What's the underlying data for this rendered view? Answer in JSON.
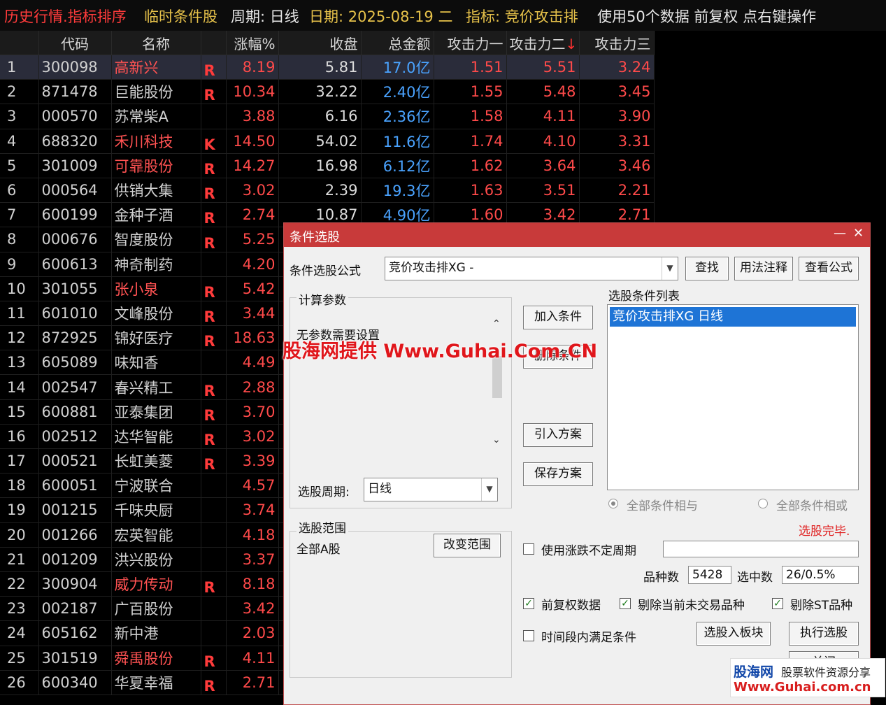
{
  "title_bar": {
    "screen": "历史行情.指标排序",
    "condition": "临时条件股",
    "period": "周期: 日线",
    "date": "日期: 2025-08-19 二",
    "indicator": "指标: 竞价攻击排",
    "data_count": "使用50个数据 前复权 点右键操作"
  },
  "colors": {
    "accent_red": "#c83a3a",
    "up": "#ff4a4a",
    "amount": "#4aa3ff",
    "title_red": "#ff3b3b",
    "title_yellow": "#e7c24a"
  },
  "table": {
    "headers": {
      "code": "代码",
      "name": "名称",
      "pct": "涨幅%",
      "close": "收盘",
      "amount": "总金额",
      "a1": "攻击力一",
      "a2": "攻击力二",
      "a2_sort": "↓",
      "a3": "攻击力三"
    },
    "rows": [
      {
        "idx": "1",
        "code": "300098",
        "name": "高新兴",
        "red": true,
        "flag": "R",
        "pct": "8.19",
        "close": "5.81",
        "amount": "17.0亿",
        "a1": "1.51",
        "a2": "5.51",
        "a3": "3.24"
      },
      {
        "idx": "2",
        "code": "871478",
        "name": "巨能股份",
        "red": false,
        "flag": "R",
        "pct": "10.34",
        "close": "32.22",
        "amount": "2.40亿",
        "a1": "1.55",
        "a2": "5.48",
        "a3": "3.45"
      },
      {
        "idx": "3",
        "code": "000570",
        "name": "苏常柴A",
        "red": false,
        "flag": "",
        "pct": "3.88",
        "close": "6.16",
        "amount": "2.36亿",
        "a1": "1.58",
        "a2": "4.11",
        "a3": "3.90"
      },
      {
        "idx": "4",
        "code": "688320",
        "name": "禾川科技",
        "red": true,
        "flag": "K",
        "pct": "14.50",
        "close": "54.02",
        "amount": "11.6亿",
        "a1": "1.74",
        "a2": "4.10",
        "a3": "3.31"
      },
      {
        "idx": "5",
        "code": "301009",
        "name": "可靠股份",
        "red": true,
        "flag": "R",
        "pct": "14.27",
        "close": "16.98",
        "amount": "6.12亿",
        "a1": "1.62",
        "a2": "3.64",
        "a3": "3.46"
      },
      {
        "idx": "6",
        "code": "000564",
        "name": "供销大集",
        "red": false,
        "flag": "R",
        "pct": "3.02",
        "close": "2.39",
        "amount": "19.3亿",
        "a1": "1.63",
        "a2": "3.51",
        "a3": "2.21"
      },
      {
        "idx": "7",
        "code": "600199",
        "name": "金种子酒",
        "red": false,
        "flag": "R",
        "pct": "2.74",
        "close": "10.87",
        "amount": "4.90亿",
        "a1": "1.60",
        "a2": "3.42",
        "a3": "2.71"
      },
      {
        "idx": "8",
        "code": "000676",
        "name": "智度股份",
        "red": false,
        "flag": "R",
        "pct": "5.25",
        "close": "",
        "amount": "",
        "a1": "",
        "a2": "",
        "a3": ""
      },
      {
        "idx": "9",
        "code": "600613",
        "name": "神奇制药",
        "red": false,
        "flag": "",
        "pct": "4.20",
        "close": "",
        "amount": "",
        "a1": "",
        "a2": "",
        "a3": ""
      },
      {
        "idx": "10",
        "code": "301055",
        "name": "张小泉",
        "red": true,
        "flag": "R",
        "pct": "5.42",
        "close": "",
        "amount": "",
        "a1": "",
        "a2": "",
        "a3": ""
      },
      {
        "idx": "11",
        "code": "601010",
        "name": "文峰股份",
        "red": false,
        "flag": "R",
        "pct": "3.44",
        "close": "",
        "amount": "",
        "a1": "",
        "a2": "",
        "a3": ""
      },
      {
        "idx": "12",
        "code": "872925",
        "name": "锦好医疗",
        "red": false,
        "flag": "R",
        "pct": "18.63",
        "close": "",
        "amount": "",
        "a1": "",
        "a2": "",
        "a3": ""
      },
      {
        "idx": "13",
        "code": "605089",
        "name": "味知香",
        "red": false,
        "flag": "",
        "pct": "4.49",
        "close": "",
        "amount": "",
        "a1": "",
        "a2": "",
        "a3": ""
      },
      {
        "idx": "14",
        "code": "002547",
        "name": "春兴精工",
        "red": false,
        "flag": "R",
        "pct": "2.88",
        "close": "",
        "amount": "",
        "a1": "",
        "a2": "",
        "a3": ""
      },
      {
        "idx": "15",
        "code": "600881",
        "name": "亚泰集团",
        "red": false,
        "flag": "R",
        "pct": "3.70",
        "close": "",
        "amount": "",
        "a1": "",
        "a2": "",
        "a3": ""
      },
      {
        "idx": "16",
        "code": "002512",
        "name": "达华智能",
        "red": false,
        "flag": "R",
        "pct": "3.02",
        "close": "",
        "amount": "",
        "a1": "",
        "a2": "",
        "a3": ""
      },
      {
        "idx": "17",
        "code": "000521",
        "name": "长虹美菱",
        "red": false,
        "flag": "R",
        "pct": "3.39",
        "close": "",
        "amount": "",
        "a1": "",
        "a2": "",
        "a3": ""
      },
      {
        "idx": "18",
        "code": "600051",
        "name": "宁波联合",
        "red": false,
        "flag": "",
        "pct": "4.57",
        "close": "",
        "amount": "",
        "a1": "",
        "a2": "",
        "a3": ""
      },
      {
        "idx": "19",
        "code": "001215",
        "name": "千味央厨",
        "red": false,
        "flag": "",
        "pct": "3.74",
        "close": "",
        "amount": "",
        "a1": "",
        "a2": "",
        "a3": ""
      },
      {
        "idx": "20",
        "code": "001266",
        "name": "宏英智能",
        "red": false,
        "flag": "",
        "pct": "4.18",
        "close": "",
        "amount": "",
        "a1": "",
        "a2": "",
        "a3": ""
      },
      {
        "idx": "21",
        "code": "001209",
        "name": "洪兴股份",
        "red": false,
        "flag": "",
        "pct": "3.37",
        "close": "",
        "amount": "",
        "a1": "",
        "a2": "",
        "a3": ""
      },
      {
        "idx": "22",
        "code": "300904",
        "name": "威力传动",
        "red": true,
        "flag": "R",
        "pct": "8.18",
        "close": "",
        "amount": "",
        "a1": "",
        "a2": "",
        "a3": ""
      },
      {
        "idx": "23",
        "code": "002187",
        "name": "广百股份",
        "red": false,
        "flag": "",
        "pct": "3.42",
        "close": "",
        "amount": "",
        "a1": "",
        "a2": "",
        "a3": ""
      },
      {
        "idx": "24",
        "code": "605162",
        "name": "新中港",
        "red": false,
        "flag": "",
        "pct": "2.03",
        "close": "",
        "amount": "",
        "a1": "",
        "a2": "",
        "a3": ""
      },
      {
        "idx": "25",
        "code": "301519",
        "name": "舜禹股份",
        "red": true,
        "flag": "R",
        "pct": "4.11",
        "close": "",
        "amount": "",
        "a1": "",
        "a2": "",
        "a3": ""
      },
      {
        "idx": "26",
        "code": "600340",
        "name": "华夏幸福",
        "red": false,
        "flag": "R",
        "pct": "2.71",
        "close": "",
        "amount": "",
        "a1": "",
        "a2": "",
        "a3": ""
      }
    ]
  },
  "dialog": {
    "title": "条件选股",
    "minimize": "—",
    "close": "✕",
    "formula_label": "条件选股公式",
    "formula_value": "竞价攻击排XG  -",
    "find_button": "查找",
    "usage_button": "用法注释",
    "view_button": "查看公式",
    "params_group": "计算参数",
    "params_text": "无参数需要设置",
    "add_condition": "加入条件",
    "delete_condition": "删除条件",
    "import_scheme": "引入方案",
    "save_scheme": "保存方案",
    "conditions_list_label": "选股条件列表",
    "conditions": [
      "竞价攻击排XG  日线"
    ],
    "period_label": "选股周期:",
    "period_value": "日线",
    "radio_and": "全部条件相与",
    "radio_or": "全部条件相或",
    "status": "选股完毕.",
    "range_group": "选股范围",
    "range_value": "全部A股",
    "change_range": "改变范围",
    "uncertain_period": "使用涨跌不定周期",
    "count_label": "品种数",
    "count_value": "5428",
    "selected_label": "选中数",
    "selected_value": "26/0.5%",
    "adj_data": "前复权数据",
    "exclude_suspended": "剔除当前未交易品种",
    "exclude_st": "剔除ST品种",
    "time_condition": "时间段内满足条件",
    "to_block": "选股入板块",
    "execute": "执行选股",
    "close_partial": "关闭"
  },
  "watermark": "股海网提供 Www.Guhai.Com.CN",
  "logo": {
    "brand": "股海网",
    "slogan": "股票软件资源分享",
    "url": "Www.Guhai.com.cn"
  }
}
